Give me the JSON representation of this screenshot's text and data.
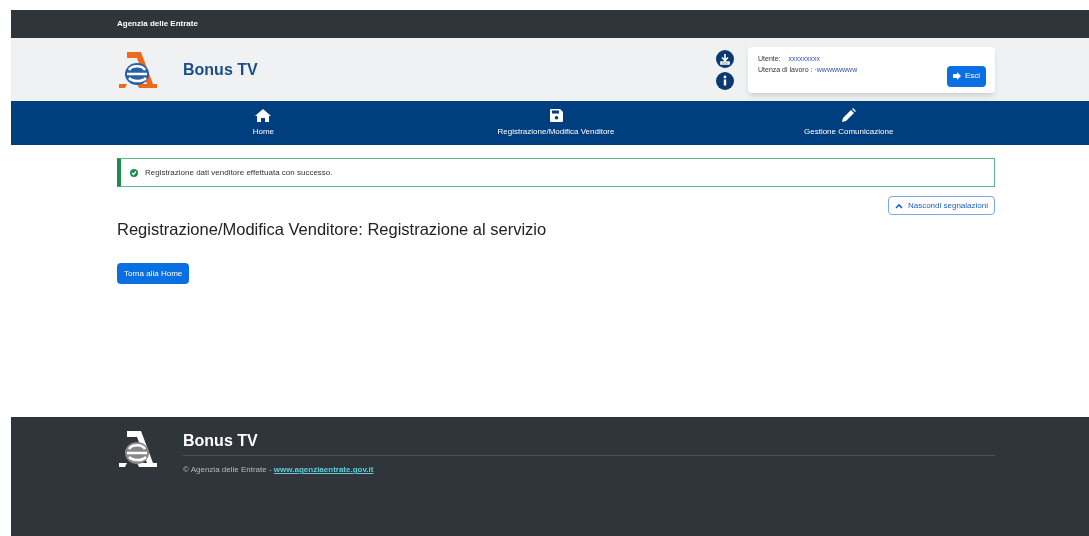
{
  "top_bar": {
    "label": "Agenzia delle Entrate"
  },
  "header": {
    "title": "Bonus TV",
    "user_box": {
      "user_label": "Utente:",
      "user_value": "xxxxxxxxx",
      "work_label": "Utenza di lavoro :",
      "work_value": "·wwwwwwww",
      "logout": "Esci"
    }
  },
  "nav": [
    {
      "kind": "home",
      "label": "Home"
    },
    {
      "kind": "save",
      "label": "Registrazione/Modifica Venditore"
    },
    {
      "kind": "edit",
      "label": "Gestione Comunicazione"
    }
  ],
  "alert": {
    "text": "Registrazione dati venditore effettuata con successo."
  },
  "toggle_button": "Nascondi segnalazioni",
  "heading": "Registrazione/Modifica Venditore: Registrazione al servizio",
  "back_button": "Torna alla Home",
  "footer": {
    "title": "Bonus TV",
    "copyright": "© Agenzia delle Entrate -",
    "link": "www.agenziaentrate.gov.it"
  }
}
